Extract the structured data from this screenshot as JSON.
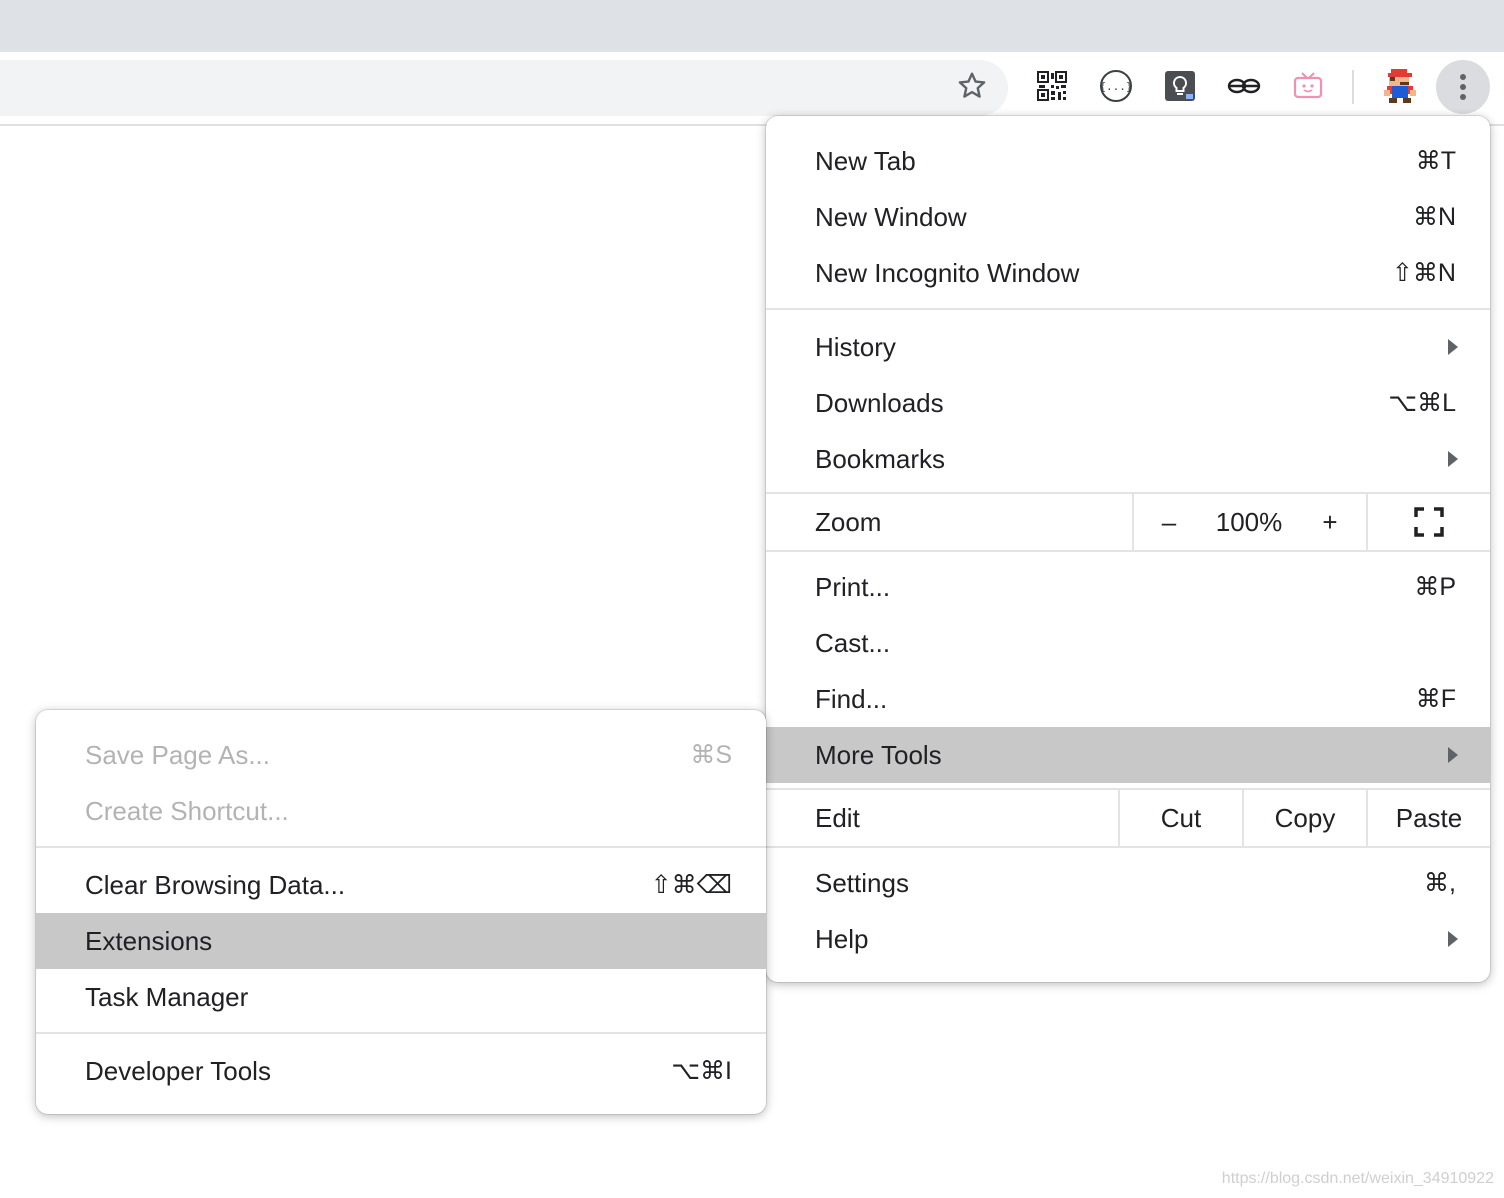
{
  "toolbar": {
    "bookmark_icon": "star-icon",
    "extensions": [
      "qr-code-icon",
      "json-viewer-icon",
      "lightbulb-icon",
      "glasses-icon",
      "tv-icon",
      "mario-avatar-icon"
    ],
    "menu_icon": "three-dot-menu-icon"
  },
  "main_menu": {
    "new_tab": {
      "label": "New Tab",
      "shortcut": "⌘T"
    },
    "new_window": {
      "label": "New Window",
      "shortcut": "⌘N"
    },
    "new_incognito": {
      "label": "New Incognito Window",
      "shortcut": "⇧⌘N"
    },
    "history": {
      "label": "History"
    },
    "downloads": {
      "label": "Downloads",
      "shortcut": "⌥⌘L"
    },
    "bookmarks": {
      "label": "Bookmarks"
    },
    "zoom": {
      "label": "Zoom",
      "minus": "–",
      "value": "100%",
      "plus": "+"
    },
    "print": {
      "label": "Print...",
      "shortcut": "⌘P"
    },
    "cast": {
      "label": "Cast..."
    },
    "find": {
      "label": "Find...",
      "shortcut": "⌘F"
    },
    "more_tools": {
      "label": "More Tools"
    },
    "edit": {
      "label": "Edit",
      "cut": "Cut",
      "copy": "Copy",
      "paste": "Paste"
    },
    "settings": {
      "label": "Settings",
      "shortcut": "⌘,"
    },
    "help": {
      "label": "Help"
    }
  },
  "sub_menu": {
    "save_page": {
      "label": "Save Page As...",
      "shortcut": "⌘S"
    },
    "create_shortcut": {
      "label": "Create Shortcut..."
    },
    "clear_data": {
      "label": "Clear Browsing Data...",
      "shortcut": "⇧⌘⌫"
    },
    "extensions": {
      "label": "Extensions"
    },
    "task_manager": {
      "label": "Task Manager"
    },
    "dev_tools": {
      "label": "Developer Tools",
      "shortcut": "⌥⌘I"
    }
  },
  "watermark": "https://blog.csdn.net/weixin_34910922"
}
